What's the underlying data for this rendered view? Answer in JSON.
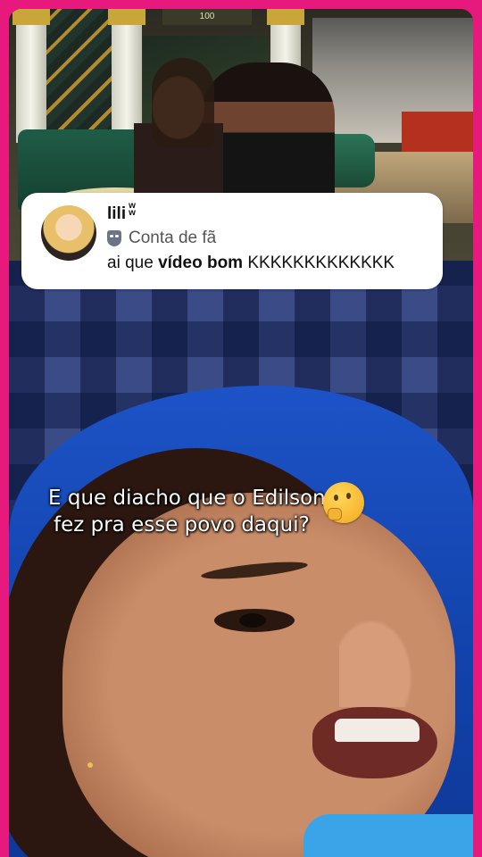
{
  "comment": {
    "username": "lili",
    "username_badge": "w w",
    "tag_icon": "theater-mask-icon",
    "tag_label": "Conta de fã",
    "text_prefix": "ai que",
    "text_bold": "vídeo bom",
    "text_suffix": "KKKKKKKKKKKKK"
  },
  "video_top": {
    "sign_text": "100"
  },
  "video_bottom": {
    "caption_line1": "E que diacho que o Edilson",
    "caption_line2": "fez pra esse povo daqui?",
    "caption_emoji": "thinking-face-emoji"
  },
  "colors": {
    "frame_border": "#e8197c",
    "card_background": "#ffffff",
    "blanket_blue": "#1d53c7"
  }
}
